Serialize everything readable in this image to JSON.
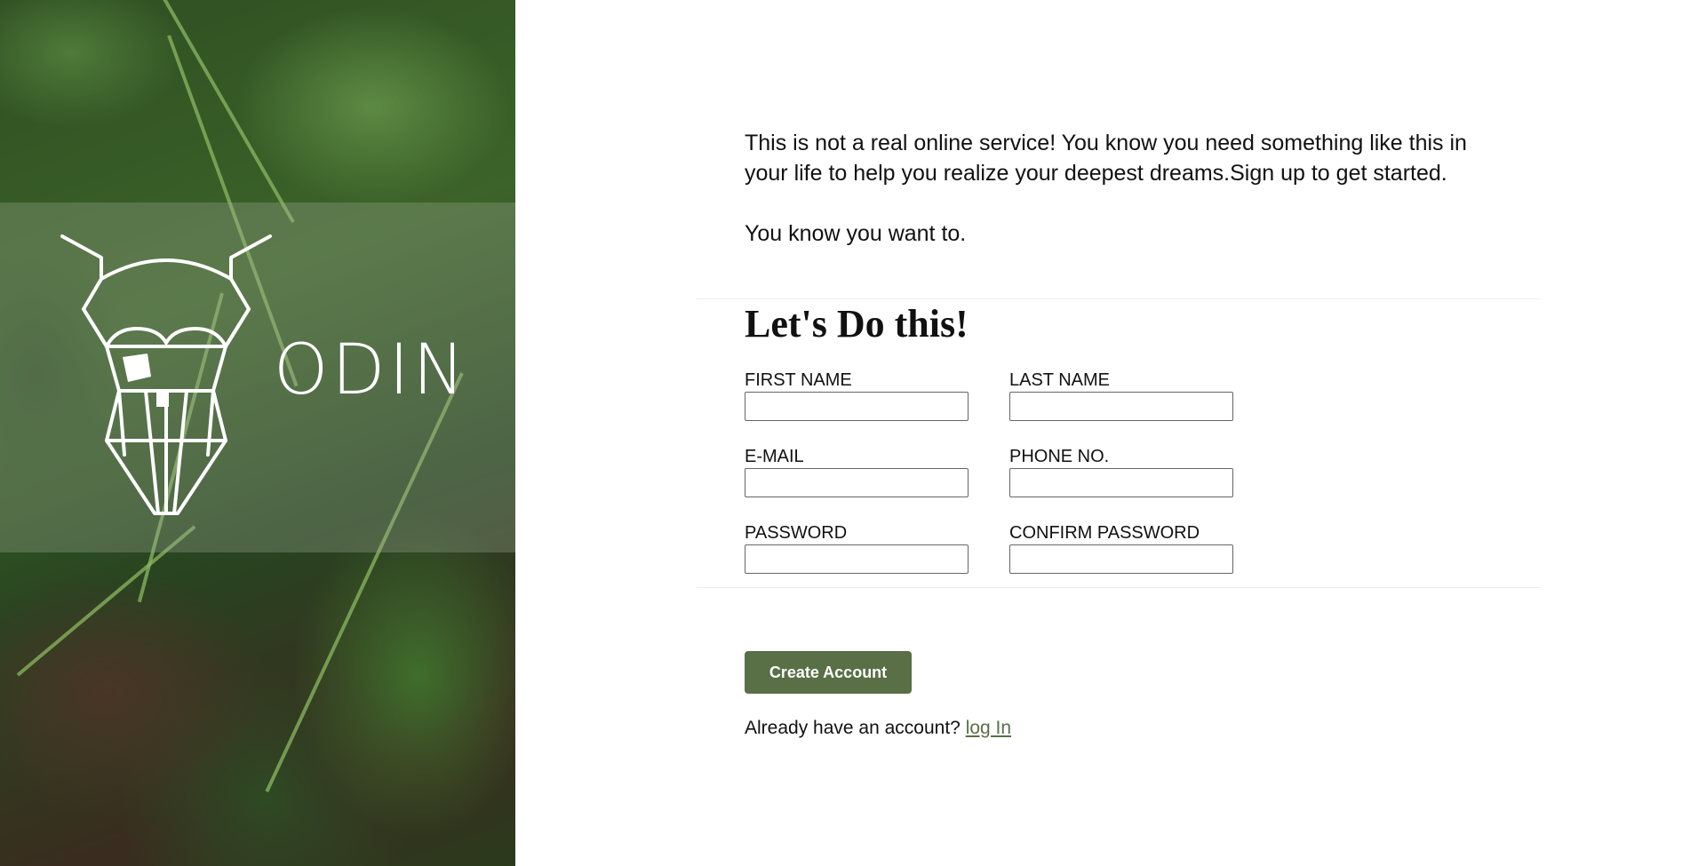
{
  "brand": {
    "name": "ODIN",
    "colors": {
      "accent": "#596f46",
      "text": "#111111",
      "background": "#ffffff"
    }
  },
  "hero": {
    "logo_icon": "odin-viking-head-icon",
    "background": "fern-foliage-photo"
  },
  "intro": {
    "paragraph1": "This is not a real online service! You know you need something like this in your life to help you realize your deepest dreams.Sign up to get started.",
    "paragraph2": "You know you want to."
  },
  "form": {
    "title": "Let's Do this!",
    "fields": {
      "first_name": {
        "label": "FIRST NAME",
        "value": ""
      },
      "last_name": {
        "label": "LAST NAME",
        "value": ""
      },
      "email": {
        "label": "E-MAIL",
        "value": ""
      },
      "phone": {
        "label": "PHONE NO.",
        "value": ""
      },
      "password": {
        "label": "PASSWORD",
        "value": ""
      },
      "confirm_password": {
        "label": "CONFIRM PASSWORD",
        "value": ""
      }
    }
  },
  "actions": {
    "create_label": "Create Account",
    "login_prompt": "Already have an account?",
    "login_link": "log In"
  }
}
